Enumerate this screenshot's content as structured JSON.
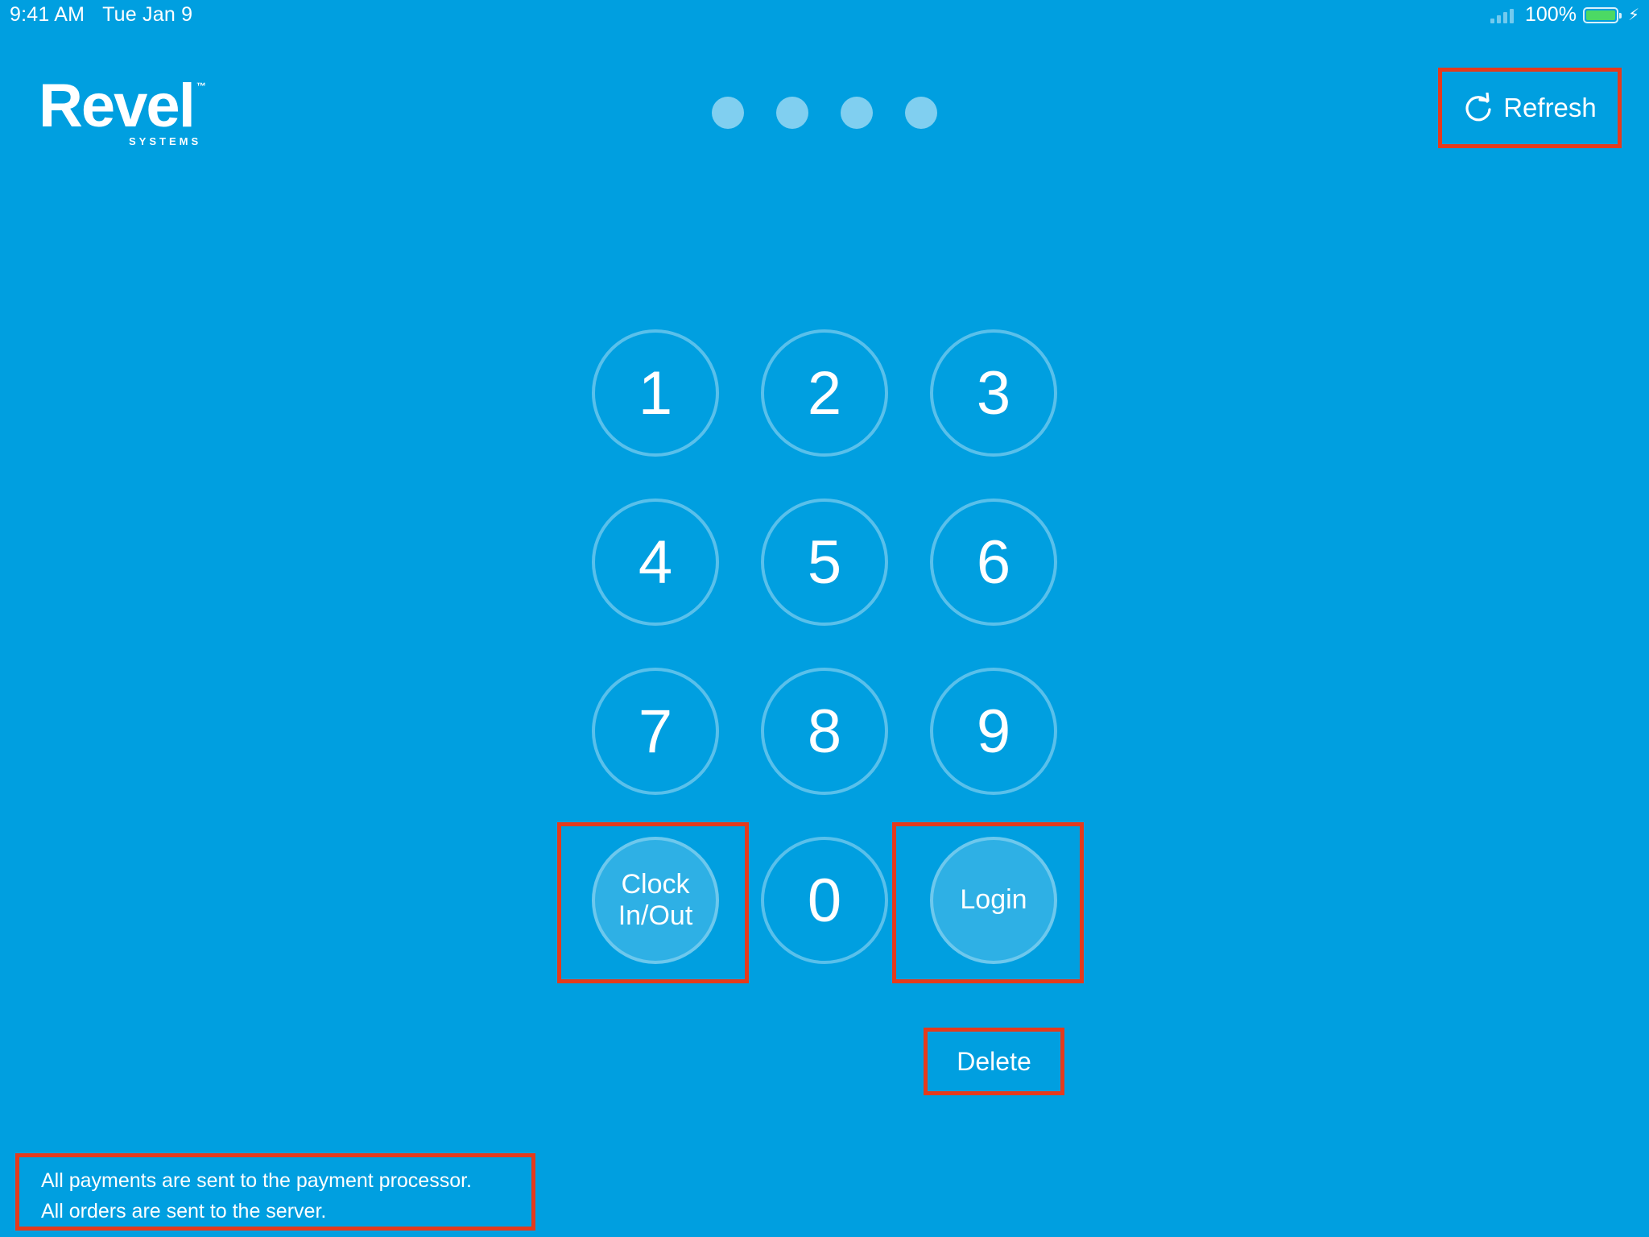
{
  "status_bar": {
    "time": "9:41 AM",
    "date": "Tue Jan 9",
    "battery_percent": "100%",
    "battery_level": 1.0
  },
  "logo": {
    "name": "Revel",
    "trademark": "™",
    "subtitle": "SYSTEMS"
  },
  "pin": {
    "dot_count": 4
  },
  "refresh_button": {
    "label": "Refresh",
    "icon": "refresh-icon"
  },
  "keypad": {
    "keys": [
      "1",
      "2",
      "3",
      "4",
      "5",
      "6",
      "7",
      "8",
      "9"
    ],
    "clock_label": "Clock\nIn/Out",
    "zero": "0",
    "login_label": "Login"
  },
  "delete_button": {
    "label": "Delete"
  },
  "footer": {
    "line1": "All payments are sent to the payment processor.",
    "line2": "All orders are sent to the server."
  },
  "colors": {
    "background": "#009fe0",
    "highlight": "#e53a1c",
    "battery": "#4cd964"
  }
}
